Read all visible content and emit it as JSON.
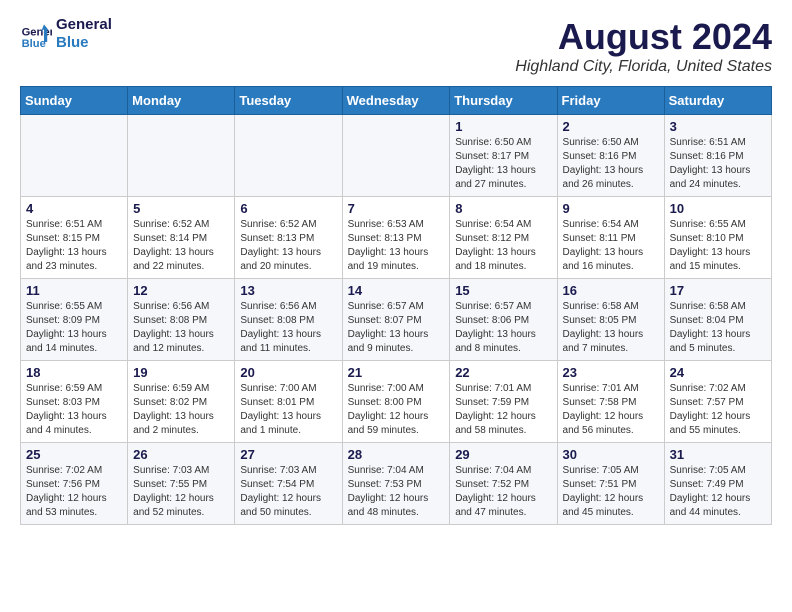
{
  "logo": {
    "line1": "General",
    "line2": "Blue"
  },
  "title": "August 2024",
  "location": "Highland City, Florida, United States",
  "headers": [
    "Sunday",
    "Monday",
    "Tuesday",
    "Wednesday",
    "Thursday",
    "Friday",
    "Saturday"
  ],
  "weeks": [
    [
      {
        "day": "",
        "sunrise": "",
        "sunset": "",
        "daylight": ""
      },
      {
        "day": "",
        "sunrise": "",
        "sunset": "",
        "daylight": ""
      },
      {
        "day": "",
        "sunrise": "",
        "sunset": "",
        "daylight": ""
      },
      {
        "day": "",
        "sunrise": "",
        "sunset": "",
        "daylight": ""
      },
      {
        "day": "1",
        "sunrise": "Sunrise: 6:50 AM",
        "sunset": "Sunset: 8:17 PM",
        "daylight": "Daylight: 13 hours and 27 minutes."
      },
      {
        "day": "2",
        "sunrise": "Sunrise: 6:50 AM",
        "sunset": "Sunset: 8:16 PM",
        "daylight": "Daylight: 13 hours and 26 minutes."
      },
      {
        "day": "3",
        "sunrise": "Sunrise: 6:51 AM",
        "sunset": "Sunset: 8:16 PM",
        "daylight": "Daylight: 13 hours and 24 minutes."
      }
    ],
    [
      {
        "day": "4",
        "sunrise": "Sunrise: 6:51 AM",
        "sunset": "Sunset: 8:15 PM",
        "daylight": "Daylight: 13 hours and 23 minutes."
      },
      {
        "day": "5",
        "sunrise": "Sunrise: 6:52 AM",
        "sunset": "Sunset: 8:14 PM",
        "daylight": "Daylight: 13 hours and 22 minutes."
      },
      {
        "day": "6",
        "sunrise": "Sunrise: 6:52 AM",
        "sunset": "Sunset: 8:13 PM",
        "daylight": "Daylight: 13 hours and 20 minutes."
      },
      {
        "day": "7",
        "sunrise": "Sunrise: 6:53 AM",
        "sunset": "Sunset: 8:13 PM",
        "daylight": "Daylight: 13 hours and 19 minutes."
      },
      {
        "day": "8",
        "sunrise": "Sunrise: 6:54 AM",
        "sunset": "Sunset: 8:12 PM",
        "daylight": "Daylight: 13 hours and 18 minutes."
      },
      {
        "day": "9",
        "sunrise": "Sunrise: 6:54 AM",
        "sunset": "Sunset: 8:11 PM",
        "daylight": "Daylight: 13 hours and 16 minutes."
      },
      {
        "day": "10",
        "sunrise": "Sunrise: 6:55 AM",
        "sunset": "Sunset: 8:10 PM",
        "daylight": "Daylight: 13 hours and 15 minutes."
      }
    ],
    [
      {
        "day": "11",
        "sunrise": "Sunrise: 6:55 AM",
        "sunset": "Sunset: 8:09 PM",
        "daylight": "Daylight: 13 hours and 14 minutes."
      },
      {
        "day": "12",
        "sunrise": "Sunrise: 6:56 AM",
        "sunset": "Sunset: 8:08 PM",
        "daylight": "Daylight: 13 hours and 12 minutes."
      },
      {
        "day": "13",
        "sunrise": "Sunrise: 6:56 AM",
        "sunset": "Sunset: 8:08 PM",
        "daylight": "Daylight: 13 hours and 11 minutes."
      },
      {
        "day": "14",
        "sunrise": "Sunrise: 6:57 AM",
        "sunset": "Sunset: 8:07 PM",
        "daylight": "Daylight: 13 hours and 9 minutes."
      },
      {
        "day": "15",
        "sunrise": "Sunrise: 6:57 AM",
        "sunset": "Sunset: 8:06 PM",
        "daylight": "Daylight: 13 hours and 8 minutes."
      },
      {
        "day": "16",
        "sunrise": "Sunrise: 6:58 AM",
        "sunset": "Sunset: 8:05 PM",
        "daylight": "Daylight: 13 hours and 7 minutes."
      },
      {
        "day": "17",
        "sunrise": "Sunrise: 6:58 AM",
        "sunset": "Sunset: 8:04 PM",
        "daylight": "Daylight: 13 hours and 5 minutes."
      }
    ],
    [
      {
        "day": "18",
        "sunrise": "Sunrise: 6:59 AM",
        "sunset": "Sunset: 8:03 PM",
        "daylight": "Daylight: 13 hours and 4 minutes."
      },
      {
        "day": "19",
        "sunrise": "Sunrise: 6:59 AM",
        "sunset": "Sunset: 8:02 PM",
        "daylight": "Daylight: 13 hours and 2 minutes."
      },
      {
        "day": "20",
        "sunrise": "Sunrise: 7:00 AM",
        "sunset": "Sunset: 8:01 PM",
        "daylight": "Daylight: 13 hours and 1 minute."
      },
      {
        "day": "21",
        "sunrise": "Sunrise: 7:00 AM",
        "sunset": "Sunset: 8:00 PM",
        "daylight": "Daylight: 12 hours and 59 minutes."
      },
      {
        "day": "22",
        "sunrise": "Sunrise: 7:01 AM",
        "sunset": "Sunset: 7:59 PM",
        "daylight": "Daylight: 12 hours and 58 minutes."
      },
      {
        "day": "23",
        "sunrise": "Sunrise: 7:01 AM",
        "sunset": "Sunset: 7:58 PM",
        "daylight": "Daylight: 12 hours and 56 minutes."
      },
      {
        "day": "24",
        "sunrise": "Sunrise: 7:02 AM",
        "sunset": "Sunset: 7:57 PM",
        "daylight": "Daylight: 12 hours and 55 minutes."
      }
    ],
    [
      {
        "day": "25",
        "sunrise": "Sunrise: 7:02 AM",
        "sunset": "Sunset: 7:56 PM",
        "daylight": "Daylight: 12 hours and 53 minutes."
      },
      {
        "day": "26",
        "sunrise": "Sunrise: 7:03 AM",
        "sunset": "Sunset: 7:55 PM",
        "daylight": "Daylight: 12 hours and 52 minutes."
      },
      {
        "day": "27",
        "sunrise": "Sunrise: 7:03 AM",
        "sunset": "Sunset: 7:54 PM",
        "daylight": "Daylight: 12 hours and 50 minutes."
      },
      {
        "day": "28",
        "sunrise": "Sunrise: 7:04 AM",
        "sunset": "Sunset: 7:53 PM",
        "daylight": "Daylight: 12 hours and 48 minutes."
      },
      {
        "day": "29",
        "sunrise": "Sunrise: 7:04 AM",
        "sunset": "Sunset: 7:52 PM",
        "daylight": "Daylight: 12 hours and 47 minutes."
      },
      {
        "day": "30",
        "sunrise": "Sunrise: 7:05 AM",
        "sunset": "Sunset: 7:51 PM",
        "daylight": "Daylight: 12 hours and 45 minutes."
      },
      {
        "day": "31",
        "sunrise": "Sunrise: 7:05 AM",
        "sunset": "Sunset: 7:49 PM",
        "daylight": "Daylight: 12 hours and 44 minutes."
      }
    ]
  ]
}
